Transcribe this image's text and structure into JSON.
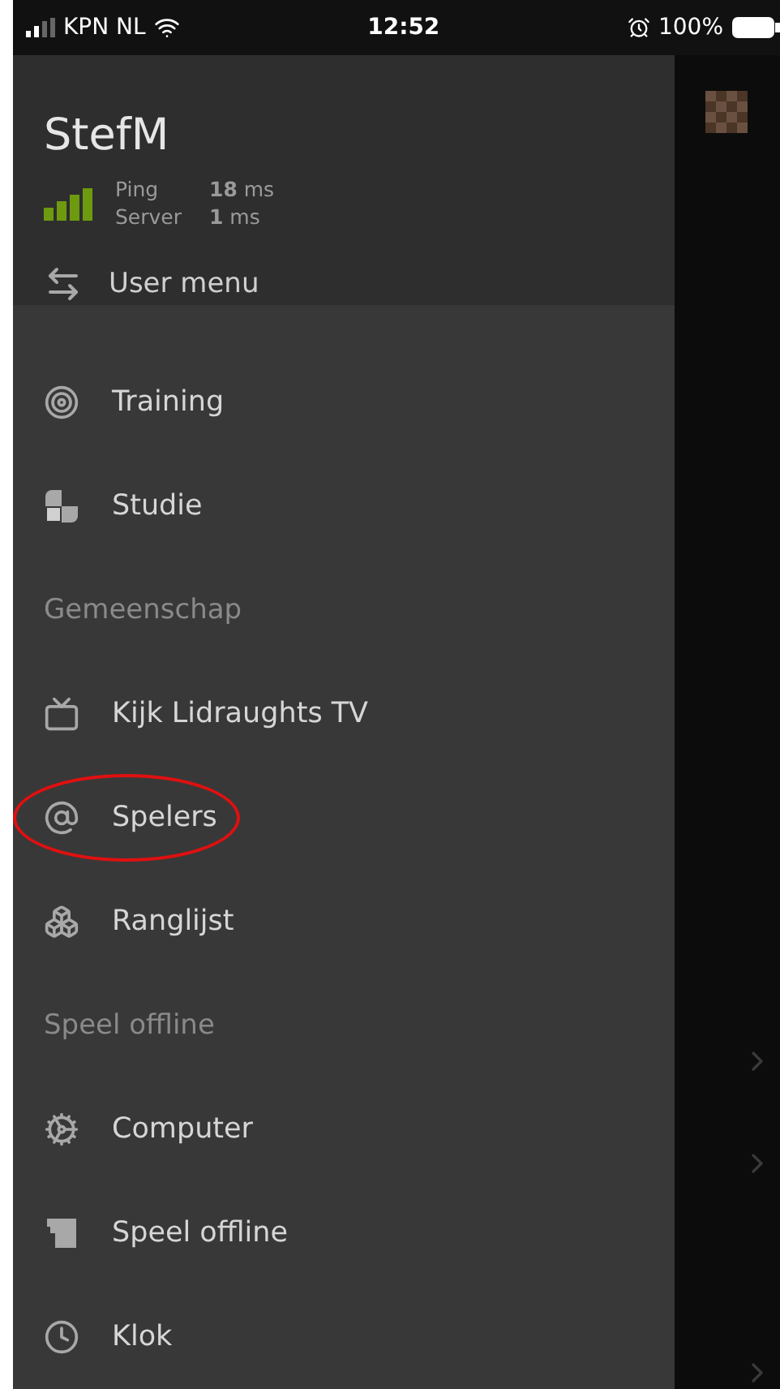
{
  "status_bar": {
    "carrier": "KPN NL",
    "time": "12:52",
    "battery": "100%"
  },
  "drawer": {
    "username": "StefM",
    "ping_label": "Ping",
    "ping_value": "**18** ms",
    "server_label": "Server",
    "server_value": "**1** ms",
    "user_menu": "User menu"
  },
  "menu": [
    {
      "kind": "item",
      "label": "Training",
      "highlighted": false
    },
    {
      "kind": "item",
      "label": "Studie",
      "highlighted": false
    },
    {
      "kind": "heading",
      "label": "Gemeenschap"
    },
    {
      "kind": "item",
      "label": "Kijk Lidraughts TV",
      "highlighted": false
    },
    {
      "kind": "item",
      "label": "Spelers",
      "highlighted": true
    },
    {
      "kind": "item",
      "label": "Ranglijst",
      "highlighted": false
    },
    {
      "kind": "heading",
      "label": "Speel offline"
    },
    {
      "kind": "item",
      "label": "Computer",
      "highlighted": false
    },
    {
      "kind": "item",
      "label": "Speel offline",
      "highlighted": false
    },
    {
      "kind": "item",
      "label": "Klok",
      "highlighted": false
    }
  ]
}
